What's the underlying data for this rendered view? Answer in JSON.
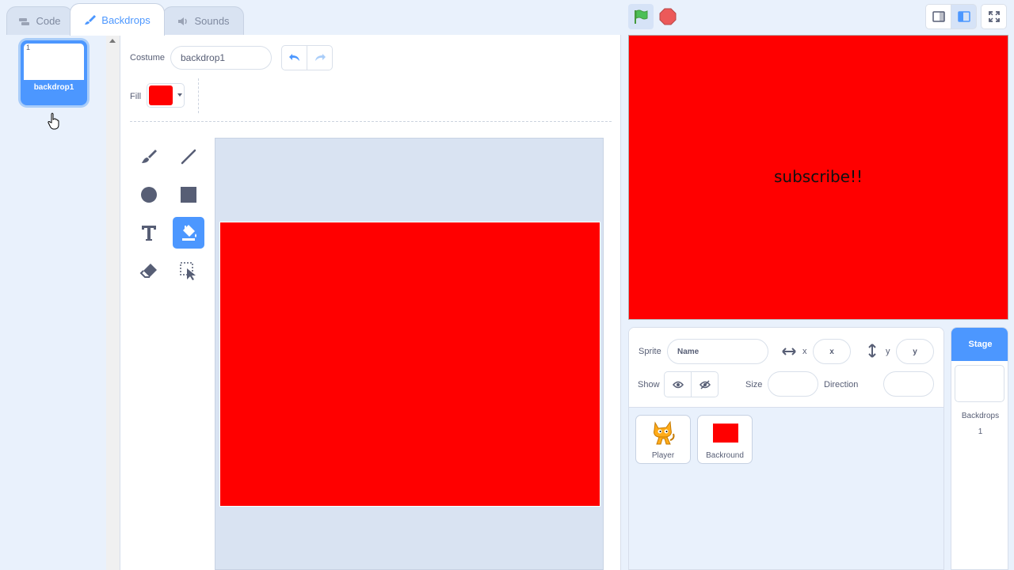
{
  "tabs": [
    {
      "label": "Code",
      "icon": "code-icon"
    },
    {
      "label": "Backdrops",
      "icon": "brush-icon"
    },
    {
      "label": "Sounds",
      "icon": "speaker-icon"
    }
  ],
  "costume_list": {
    "items": [
      {
        "number": "1",
        "name": "backdrop1"
      }
    ]
  },
  "paint_editor": {
    "costume_label": "Costume",
    "costume_name": "backdrop1",
    "fill_label": "Fill",
    "fill_color": "#ff0000",
    "tools": [
      "brush-icon",
      "line-icon",
      "circle-icon",
      "rectangle-icon",
      "text-icon",
      "fill-icon",
      "eraser-icon",
      "select-icon"
    ],
    "active_tool": "fill-icon"
  },
  "stage": {
    "text": "subscribe!!",
    "background": "#ff0000"
  },
  "sprite_info": {
    "sprite_label": "Sprite",
    "name_placeholder": "Name",
    "x_label": "x",
    "x_placeholder": "x",
    "y_label": "y",
    "y_placeholder": "y",
    "show_label": "Show",
    "size_label": "Size",
    "direction_label": "Direction"
  },
  "sprites": [
    {
      "name": "Player",
      "icon": "cat-sprite-icon"
    },
    {
      "name": "Backround",
      "icon": "red-rectangle-icon"
    }
  ],
  "stage_selector": {
    "title": "Stage",
    "backdrops_label": "Backdrops",
    "backdrops_count": "1"
  },
  "colors": {
    "accent": "#4c97ff",
    "stop": "#ec5959",
    "flag": "#4cbf56",
    "fill": "#ff0000"
  }
}
